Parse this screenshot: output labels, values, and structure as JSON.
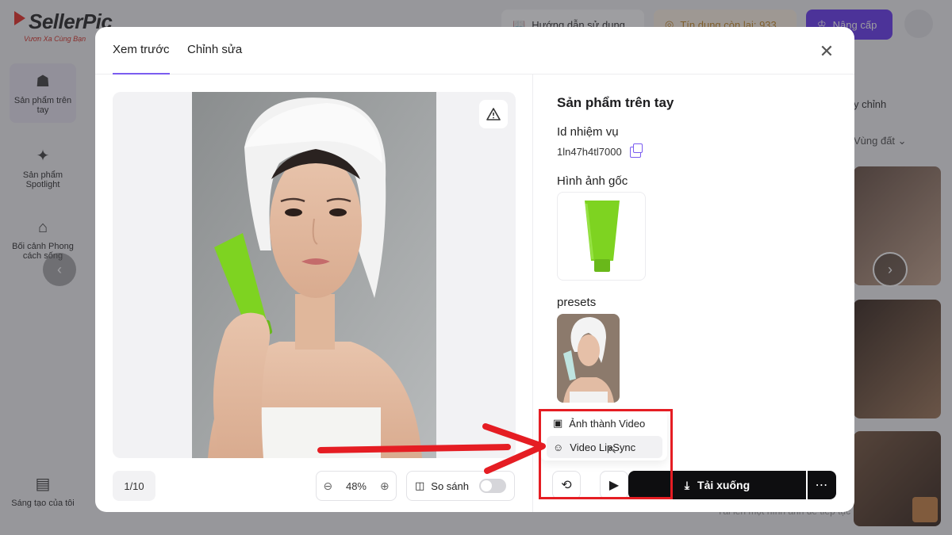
{
  "app": {
    "logo_text": "SellerPic",
    "logo_tagline": "Vươn Xa Cùng Bạn",
    "guide_label": "Hướng dẫn sử dụng",
    "credits_label": "Tín dụng còn lại: 933",
    "upgrade_label": "Nâng cấp"
  },
  "sidebar": {
    "items": [
      {
        "label": "Sản phẩm trên tay",
        "icon": "hand-product-icon"
      },
      {
        "label": "Sản phẩm Spotlight",
        "icon": "spotlight-icon"
      },
      {
        "label": "Bối cảnh Phong cách sống",
        "icon": "lifestyle-icon"
      },
      {
        "label": "Sáng tạo của tôi",
        "icon": "folder-icon"
      }
    ]
  },
  "right_panel": {
    "label": "y chỉnh",
    "select_label": "Vùng đất",
    "bottom_hint": "Tải lên một hình ảnh để tiếp tục"
  },
  "modal": {
    "tabs": [
      "Xem trước",
      "Chỉnh sửa"
    ],
    "active_tab": "Xem trước",
    "page_counter": "1/10",
    "zoom_level": "48%",
    "compare_label": "So sánh",
    "compare_enabled": false,
    "info": {
      "title": "Sản phẩm trên tay",
      "task_id_label": "Id nhiệm vụ",
      "task_id": "1ln47h4tl7000",
      "original_image_label": "Hình ảnh gốc",
      "presets_label": "presets"
    },
    "actions": {
      "download_label": "Tải xuống",
      "more_label": "⋯"
    },
    "menu": {
      "items": [
        "Ảnh thành Video",
        "Video LipSync"
      ],
      "hovered": "Video LipSync"
    }
  },
  "colors": {
    "accent": "#7a5cf0",
    "annotation_red": "#e51d23",
    "download_bg": "#0e0e10",
    "product_green": "#7ed321"
  }
}
